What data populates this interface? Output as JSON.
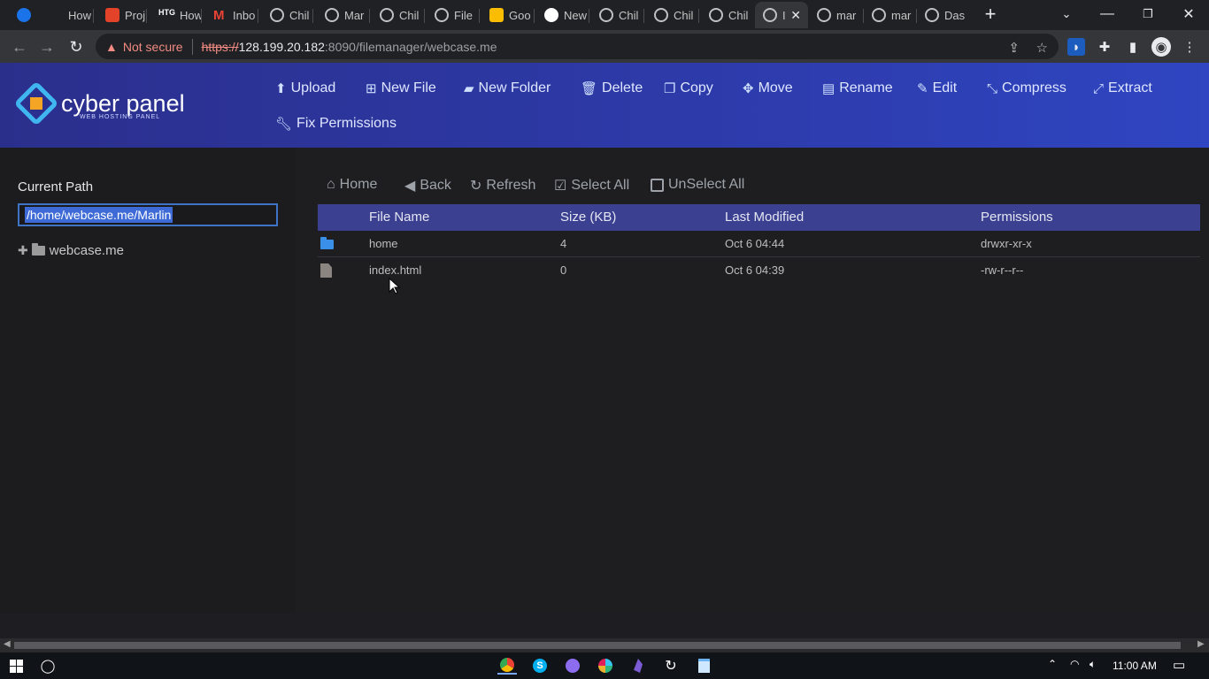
{
  "browser": {
    "tabs": [
      {
        "icon": "k-icon",
        "label": ""
      },
      {
        "icon": "chrome-icon",
        "label": "How"
      },
      {
        "icon": "gitlab-icon",
        "label": "Proj"
      },
      {
        "icon": "htg-icon",
        "label": "How"
      },
      {
        "icon": "gmail-icon",
        "label": "Inbo"
      },
      {
        "icon": "globe-icon",
        "label": "Chil"
      },
      {
        "icon": "globe-icon",
        "label": "Mar"
      },
      {
        "icon": "globe-icon",
        "label": "Chil"
      },
      {
        "icon": "globe-icon",
        "label": "File"
      },
      {
        "icon": "keep-icon",
        "label": "Goo"
      },
      {
        "icon": "chrome-icon",
        "label": "New"
      },
      {
        "icon": "globe-icon",
        "label": "Chil"
      },
      {
        "icon": "globe-icon",
        "label": "Chil"
      },
      {
        "icon": "globe-icon",
        "label": "Chil"
      },
      {
        "icon": "globe-icon",
        "label": "I",
        "active": true
      },
      {
        "icon": "globe-icon",
        "label": "mar"
      },
      {
        "icon": "globe-icon",
        "label": "mar"
      },
      {
        "icon": "globe-icon",
        "label": "Das"
      }
    ],
    "security_label": "Not secure",
    "url_scheme": "https://",
    "url_host": "128.199.20.182",
    "url_rest": ":8090/filemanager/webcase.me"
  },
  "app": {
    "logo_text": "cyber panel",
    "logo_sub": "WEB HOSTING PANEL",
    "toolbar": {
      "upload": "Upload",
      "new_file": "New File",
      "new_folder": "New Folder",
      "delete": "Delete",
      "copy": "Copy",
      "move": "Move",
      "rename": "Rename",
      "edit": "Edit",
      "compress": "Compress",
      "extract": "Extract",
      "fix_permissions": "Fix Permissions"
    }
  },
  "sidebar": {
    "current_path_label": "Current Path",
    "current_path_value": "/home/webcase.me/Marlin",
    "tree_root": "webcase.me"
  },
  "filebar": {
    "home": "Home",
    "back": "Back",
    "refresh": "Refresh",
    "select_all": "Select All",
    "unselect_all": "UnSelect All"
  },
  "table": {
    "headers": [
      "File Name",
      "Size (KB)",
      "Last Modified",
      "Permissions"
    ],
    "rows": [
      {
        "type": "folder",
        "name": "home",
        "size": "4",
        "modified": "Oct 6 04:44",
        "permissions": "drwxr-xr-x"
      },
      {
        "type": "file",
        "name": "index.html",
        "size": "0",
        "modified": "Oct 6 04:39",
        "permissions": "-rw-r--r--"
      }
    ]
  },
  "taskbar": {
    "time": "11:00 AM"
  }
}
